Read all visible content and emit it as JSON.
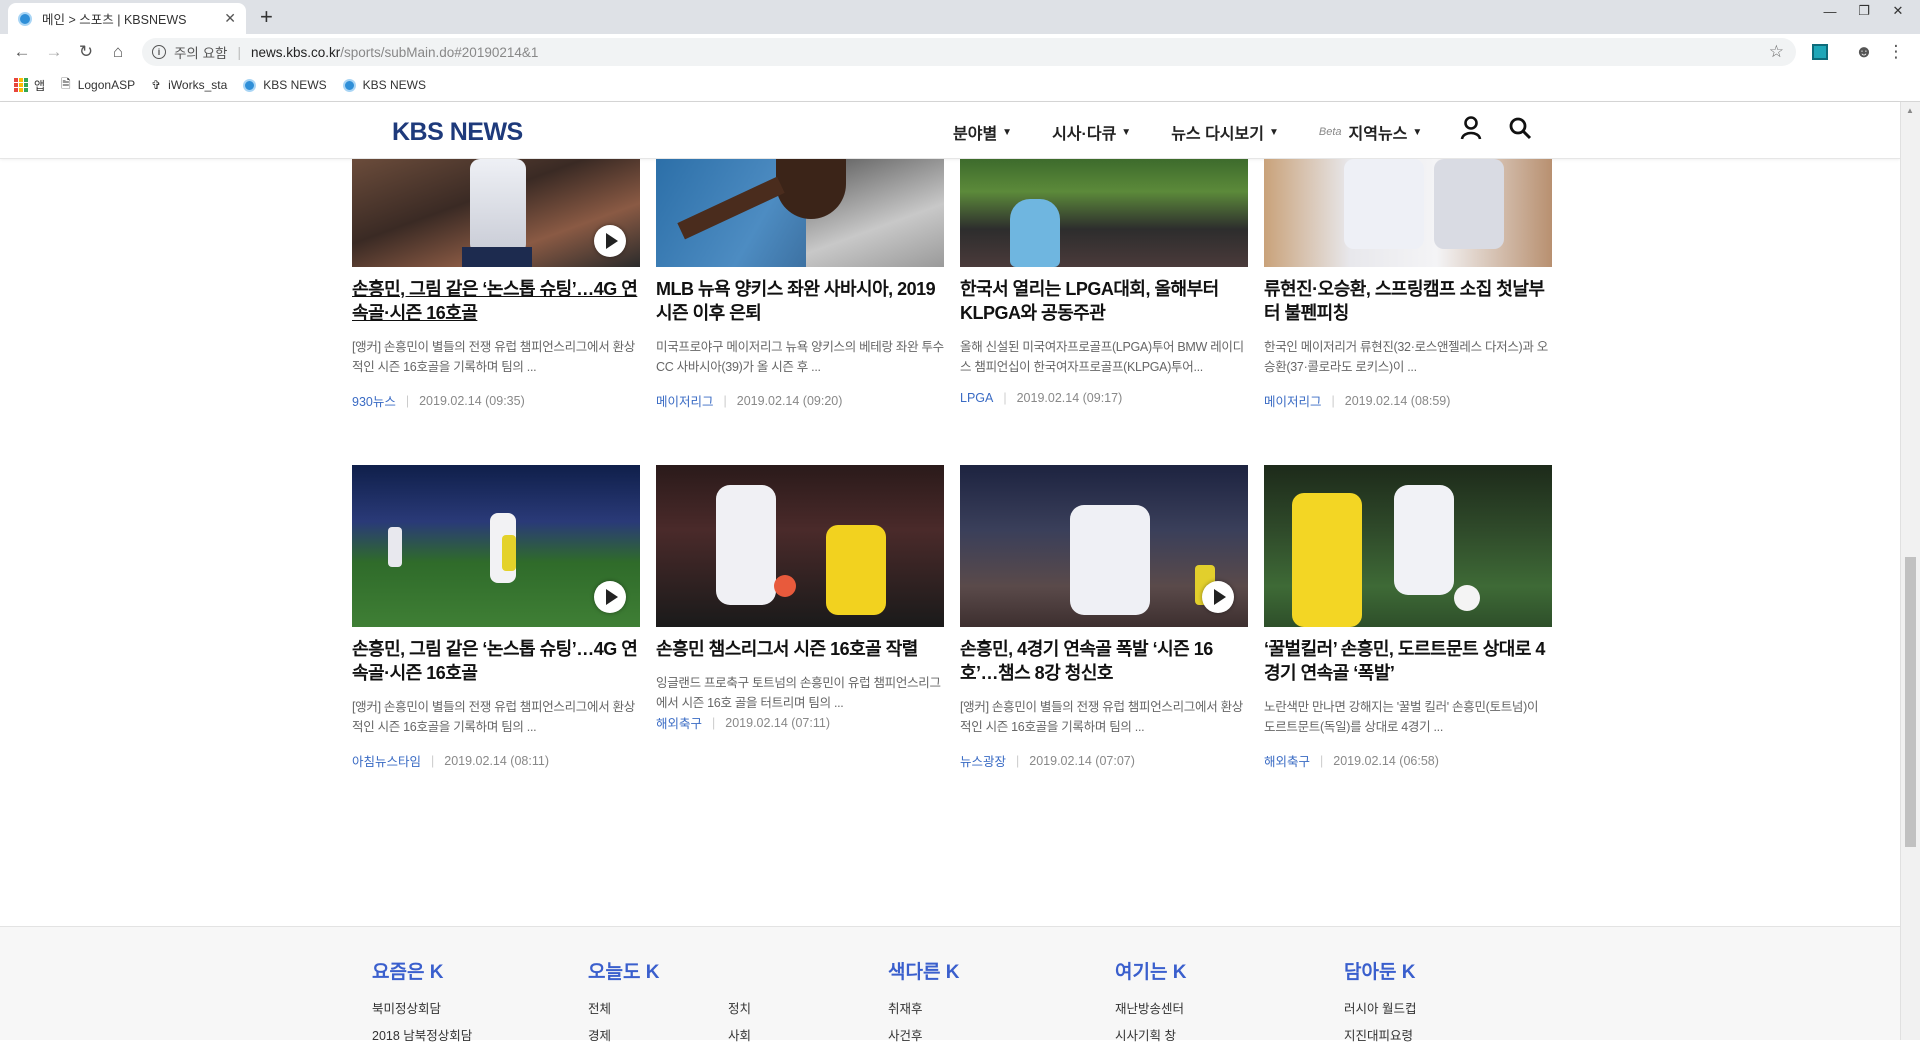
{
  "browser": {
    "tab_title": "메인 > 스포츠 | KBSNEWS",
    "tab_close": "✕",
    "new_tab": "+",
    "security_label": "주의 요함",
    "url_host": "news.kbs.co.kr",
    "url_path": "/sports/subMain.do#20190214&1",
    "bookmarks": [
      {
        "label": "앱",
        "icon": "apps-icon"
      },
      {
        "label": "LogonASP",
        "icon": "page-icon"
      },
      {
        "label": "iWorks_sta",
        "icon": "feather-icon"
      },
      {
        "label": "KBS NEWS",
        "icon": "kbs-icon"
      },
      {
        "label": "KBS NEWS",
        "icon": "kbs-icon"
      }
    ]
  },
  "site": {
    "logo": "KBS NEWS",
    "nav": [
      {
        "label": "분야별"
      },
      {
        "label": "시사·다큐"
      },
      {
        "label": "뉴스 다시보기"
      },
      {
        "label": "지역뉴스",
        "badge": "Beta"
      }
    ]
  },
  "articles_row1": [
    {
      "title": "손흥민, 그림 같은 ‘논스톱 슈팅’…4G 연속골·시즌 16호골",
      "summary": "[앵커] 손흥민이 별들의 전쟁 유럽 챔피언스리그에서 환상적인 시즌 16호골을 기록하며 팀의 ...",
      "category": "930뉴스",
      "date": "2019.02.14 (09:35)",
      "video": true,
      "underline": true
    },
    {
      "title": "MLB 뉴욕 양키스 좌완 사바시아, 2019 시즌 이후 은퇴",
      "summary": "미국프로야구 메이저리그 뉴욕 양키스의 베테랑 좌완 투수 CC 사바시아(39)가 올 시즌 후 ...",
      "category": "메이저리그",
      "date": "2019.02.14 (09:20)",
      "video": false
    },
    {
      "title": "한국서 열리는 LPGA대회, 올해부터 KLPGA와 공동주관",
      "summary": "올해 신설된 미국여자프로골프(LPGA)투어 BMW 레이디스 챔피언십이 한국여자프로골프(KLPGA)투어...",
      "category": "LPGA",
      "date": "2019.02.14 (09:17)",
      "video": false
    },
    {
      "title": "류현진·오승환, 스프링캠프 소집 첫날부터 불펜피칭",
      "summary": "한국인 메이저리거 류현진(32·로스앤젤레스 다저스)과 오승환(37·콜로라도 로키스)이 ...",
      "category": "메이저리그",
      "date": "2019.02.14 (08:59)",
      "video": false
    }
  ],
  "articles_row2": [
    {
      "title": "손흥민, 그림 같은 ‘논스톱 슈팅’…4G 연속골·시즌 16호골",
      "summary": "[앵커] 손흥민이 별들의 전쟁 유럽 챔피언스리그에서 환상적인 시즌 16호골을 기록하며 팀의 ...",
      "category": "아침뉴스타임",
      "date": "2019.02.14 (08:11)",
      "video": true
    },
    {
      "title": "손흥민 챔스리그서 시즌 16호골 작렬",
      "summary": "잉글랜드 프로축구 토트넘의 손흥민이 유럽 챔피언스리그에서 시즌 16호 골을 터트리며 팀의 ...",
      "category": "해외축구",
      "date": "2019.02.14 (07:11)",
      "video": false
    },
    {
      "title": "손흥민, 4경기 연속골 폭발 ‘시즌 16호’…챔스 8강 청신호",
      "summary": "[앵커] 손흥민이 별들의 전쟁 유럽 챔피언스리그에서 환상적인 시즌 16호골을 기록하며 팀의 ...",
      "category": "뉴스광장",
      "date": "2019.02.14 (07:07)",
      "video": true
    },
    {
      "title": "‘꿀벌킬러’ 손흥민, 도르트문트 상대로 4경기 연속골 ‘폭발’",
      "summary": "노란색만 만나면 강해지는 '꿀벌 킬러' 손흥민(토트넘)이 도르트문트(독일)를 상대로 4경기 ...",
      "category": "해외축구",
      "date": "2019.02.14 (06:58)",
      "video": false
    }
  ],
  "footer": {
    "col1": {
      "heading": "요즘은 K",
      "links": [
        "북미정상회담",
        "2018 남북정상회담"
      ]
    },
    "col2": {
      "heading": "오늘도 K",
      "links": [
        "전체",
        "정치",
        "경제",
        "사회"
      ]
    },
    "col3": {
      "heading": "색다른 K",
      "links": [
        "취재후",
        "사건후"
      ]
    },
    "col4": {
      "heading": "여기는 K",
      "links": [
        "재난방송센터",
        "시사기획 창"
      ]
    },
    "col5": {
      "heading": "담아둔 K",
      "links": [
        "러시아 월드컵",
        "지진대피요령"
      ]
    }
  },
  "colors": {
    "brand": "#1e3a7b",
    "category": "#3a6bc4",
    "footer_heading": "#3a5fcd"
  }
}
